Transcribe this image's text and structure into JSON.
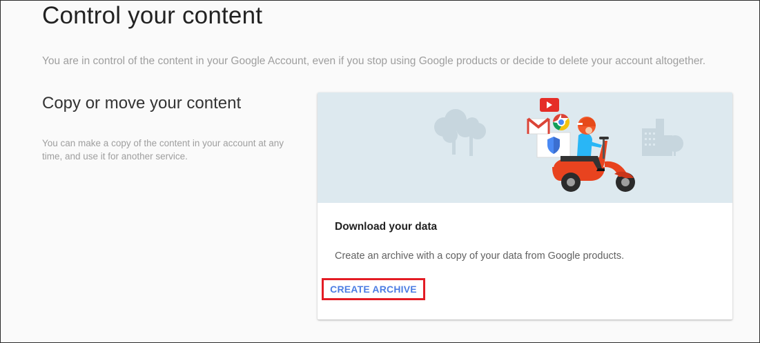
{
  "page": {
    "title": "Control your content",
    "intro": "You are in control of the content in your Google Account, even if you stop using Google products or decide to delete your account altogether."
  },
  "section": {
    "title": "Copy or move your content",
    "description": "You can make a copy of the content in your account at any time, and use it for another service."
  },
  "card": {
    "illustration": "scooter-delivery-illustration",
    "title": "Download your data",
    "description": "Create an archive with a copy of your data from Google products.",
    "action_label": "CREATE ARCHIVE"
  },
  "colors": {
    "hero_background": "#dde9ef",
    "action_text": "#4c7de3",
    "highlight_border": "#e31c24",
    "scooter": "#e8431f"
  }
}
